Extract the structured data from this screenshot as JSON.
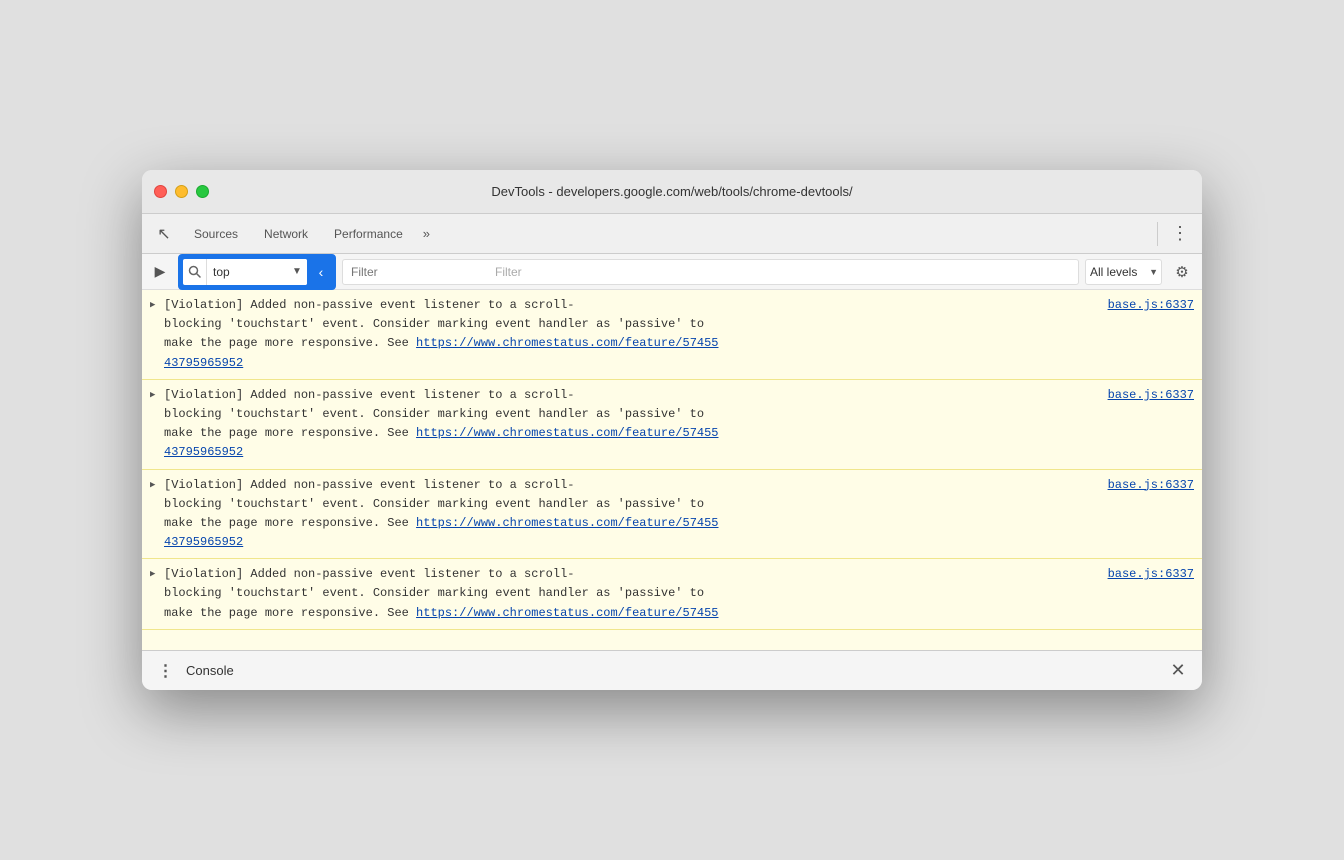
{
  "window": {
    "title": "DevTools - developers.google.com/web/tools/chrome-devtools/"
  },
  "toolbar": {
    "tabs": [
      "Sources",
      "Network",
      "Performance"
    ],
    "more_label": "»",
    "menu_label": "⋮",
    "inspector_icon": "↖",
    "run_icon": "▶"
  },
  "console_toolbar": {
    "context_value": "top",
    "filter_placeholder": "Filter",
    "log_level_label": "All levels",
    "settings_icon": "⚙"
  },
  "log_entries": [
    {
      "id": 1,
      "source": "base.js:6337",
      "text_line1": "[Violation] Added non-passive event listener to a scroll-",
      "text_line2": "blocking 'touchstart' event. Consider marking event handler as 'passive' to",
      "text_line3": "make the page more responsive. See ",
      "link_url": "https://www.chromestatus.com/feature/57455",
      "link_text": "https://www.chromestatus.com/feature/57455",
      "link_text2": "43795965952",
      "partial": false
    },
    {
      "id": 2,
      "source": "base.js:6337",
      "text_line1": "[Violation] Added non-passive event listener to a scroll-",
      "text_line2": "blocking 'touchstart' event. Consider marking event handler as 'passive' to",
      "text_line3": "make the page more responsive. See ",
      "link_url": "https://www.chromestatus.com/feature/57455",
      "link_text": "https://www.chromestatus.com/feature/57455",
      "link_text2": "43795965952",
      "partial": false
    },
    {
      "id": 3,
      "source": "base.js:6337",
      "text_line1": "[Violation] Added non-passive event listener to a scroll-",
      "text_line2": "blocking 'touchstart' event. Consider marking event handler as 'passive' to",
      "text_line3": "make the page more responsive. See ",
      "link_url": "https://www.chromestatus.com/feature/57455",
      "link_text": "https://www.chromestatus.com/feature/57455",
      "link_text2": "43795965952",
      "partial": false
    },
    {
      "id": 4,
      "source": "base.js:6337",
      "text_line1": "[Violation] Added non-passive event listener to a scroll-",
      "text_line2": "blocking 'touchstart' event. Consider marking event handler as 'passive' to",
      "text_line3": "make the page more responsive. See https://www.chromestatus.com/feature/57455",
      "partial": true
    }
  ],
  "bottom_bar": {
    "menu_icon": "⋮",
    "title": "Console",
    "close_icon": "✕"
  }
}
